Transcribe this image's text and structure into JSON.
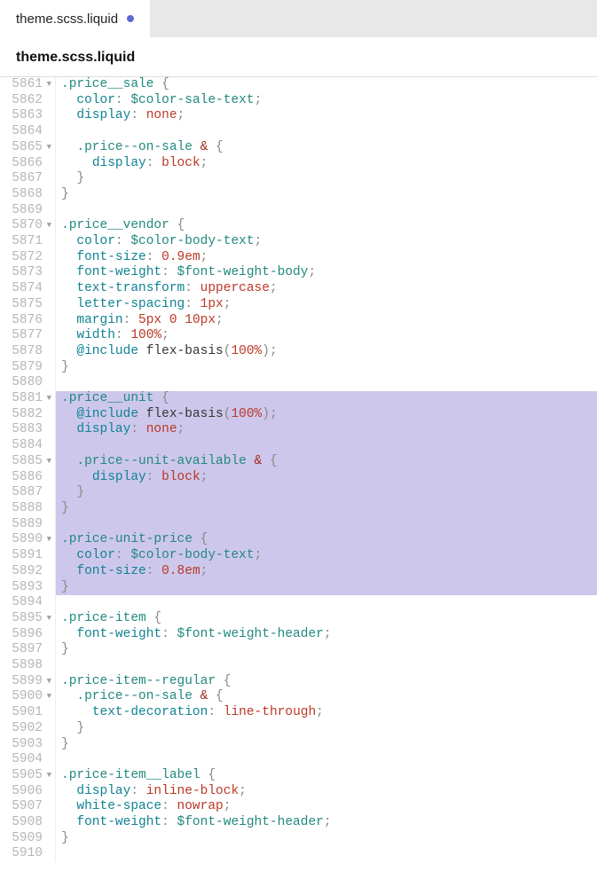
{
  "tab": {
    "filename": "theme.scss.liquid",
    "modified": true
  },
  "breadcrumb": "theme.scss.liquid",
  "gutter_start": 5861,
  "highlighted_range": [
    5881,
    5893
  ],
  "fold_lines": [
    5861,
    5865,
    5870,
    5881,
    5885,
    5890,
    5895,
    5899,
    5900,
    5905
  ],
  "lines": [
    {
      "n": 5861,
      "tokens": [
        [
          "sel",
          ".price__sale"
        ],
        [
          "punc",
          " {"
        ]
      ]
    },
    {
      "n": 5862,
      "tokens": [
        [
          "ws",
          "  "
        ],
        [
          "prop",
          "color"
        ],
        [
          "punc",
          ": "
        ],
        [
          "var",
          "$color-sale-text"
        ],
        [
          "punc",
          ";"
        ]
      ]
    },
    {
      "n": 5863,
      "tokens": [
        [
          "ws",
          "  "
        ],
        [
          "prop",
          "display"
        ],
        [
          "punc",
          ": "
        ],
        [
          "val",
          "none"
        ],
        [
          "punc",
          ";"
        ]
      ]
    },
    {
      "n": 5864,
      "tokens": []
    },
    {
      "n": 5865,
      "tokens": [
        [
          "ws",
          "  "
        ],
        [
          "sel",
          ".price--on-sale"
        ],
        [
          "punc",
          " "
        ],
        [
          "amp",
          "&"
        ],
        [
          "punc",
          " {"
        ]
      ]
    },
    {
      "n": 5866,
      "tokens": [
        [
          "ws",
          "    "
        ],
        [
          "prop",
          "display"
        ],
        [
          "punc",
          ": "
        ],
        [
          "val",
          "block"
        ],
        [
          "punc",
          ";"
        ]
      ]
    },
    {
      "n": 5867,
      "tokens": [
        [
          "ws",
          "  "
        ],
        [
          "brace",
          "}"
        ]
      ]
    },
    {
      "n": 5868,
      "tokens": [
        [
          "brace",
          "}"
        ]
      ]
    },
    {
      "n": 5869,
      "tokens": []
    },
    {
      "n": 5870,
      "tokens": [
        [
          "sel",
          ".price__vendor"
        ],
        [
          "punc",
          " {"
        ]
      ]
    },
    {
      "n": 5871,
      "tokens": [
        [
          "ws",
          "  "
        ],
        [
          "prop",
          "color"
        ],
        [
          "punc",
          ": "
        ],
        [
          "var",
          "$color-body-text"
        ],
        [
          "punc",
          ";"
        ]
      ]
    },
    {
      "n": 5872,
      "tokens": [
        [
          "ws",
          "  "
        ],
        [
          "prop",
          "font-size"
        ],
        [
          "punc",
          ": "
        ],
        [
          "val",
          "0.9em"
        ],
        [
          "punc",
          ";"
        ]
      ]
    },
    {
      "n": 5873,
      "tokens": [
        [
          "ws",
          "  "
        ],
        [
          "prop",
          "font-weight"
        ],
        [
          "punc",
          ": "
        ],
        [
          "var",
          "$font-weight-body"
        ],
        [
          "punc",
          ";"
        ]
      ]
    },
    {
      "n": 5874,
      "tokens": [
        [
          "ws",
          "  "
        ],
        [
          "prop",
          "text-transform"
        ],
        [
          "punc",
          ": "
        ],
        [
          "val",
          "uppercase"
        ],
        [
          "punc",
          ";"
        ]
      ]
    },
    {
      "n": 5875,
      "tokens": [
        [
          "ws",
          "  "
        ],
        [
          "prop",
          "letter-spacing"
        ],
        [
          "punc",
          ": "
        ],
        [
          "val",
          "1px"
        ],
        [
          "punc",
          ";"
        ]
      ]
    },
    {
      "n": 5876,
      "tokens": [
        [
          "ws",
          "  "
        ],
        [
          "prop",
          "margin"
        ],
        [
          "punc",
          ": "
        ],
        [
          "val",
          "5px 0 10px"
        ],
        [
          "punc",
          ";"
        ]
      ]
    },
    {
      "n": 5877,
      "tokens": [
        [
          "ws",
          "  "
        ],
        [
          "prop",
          "width"
        ],
        [
          "punc",
          ": "
        ],
        [
          "val",
          "100%"
        ],
        [
          "punc",
          ";"
        ]
      ]
    },
    {
      "n": 5878,
      "tokens": [
        [
          "ws",
          "  "
        ],
        [
          "at",
          "@include"
        ],
        [
          "punc",
          " "
        ],
        [
          "fn",
          "flex-basis"
        ],
        [
          "punc",
          "("
        ],
        [
          "val",
          "100%"
        ],
        [
          "punc",
          ");"
        ]
      ]
    },
    {
      "n": 5879,
      "tokens": [
        [
          "brace",
          "}"
        ]
      ]
    },
    {
      "n": 5880,
      "tokens": []
    },
    {
      "n": 5881,
      "tokens": [
        [
          "sel",
          ".price__unit"
        ],
        [
          "punc",
          " {"
        ]
      ]
    },
    {
      "n": 5882,
      "tokens": [
        [
          "ws",
          "  "
        ],
        [
          "at",
          "@include"
        ],
        [
          "punc",
          " "
        ],
        [
          "fn",
          "flex-basis"
        ],
        [
          "punc",
          "("
        ],
        [
          "val",
          "100%"
        ],
        [
          "punc",
          ");"
        ]
      ]
    },
    {
      "n": 5883,
      "tokens": [
        [
          "ws",
          "  "
        ],
        [
          "prop",
          "display"
        ],
        [
          "punc",
          ": "
        ],
        [
          "val",
          "none"
        ],
        [
          "punc",
          ";"
        ]
      ]
    },
    {
      "n": 5884,
      "tokens": []
    },
    {
      "n": 5885,
      "tokens": [
        [
          "ws",
          "  "
        ],
        [
          "sel",
          ".price--unit-available"
        ],
        [
          "punc",
          " "
        ],
        [
          "amp",
          "&"
        ],
        [
          "punc",
          " {"
        ]
      ]
    },
    {
      "n": 5886,
      "tokens": [
        [
          "ws",
          "    "
        ],
        [
          "prop",
          "display"
        ],
        [
          "punc",
          ": "
        ],
        [
          "val",
          "block"
        ],
        [
          "punc",
          ";"
        ]
      ]
    },
    {
      "n": 5887,
      "tokens": [
        [
          "ws",
          "  "
        ],
        [
          "brace",
          "}"
        ]
      ]
    },
    {
      "n": 5888,
      "tokens": [
        [
          "brace",
          "}"
        ]
      ]
    },
    {
      "n": 5889,
      "tokens": []
    },
    {
      "n": 5890,
      "tokens": [
        [
          "sel",
          ".price-unit-price"
        ],
        [
          "punc",
          " {"
        ]
      ]
    },
    {
      "n": 5891,
      "tokens": [
        [
          "ws",
          "  "
        ],
        [
          "prop",
          "color"
        ],
        [
          "punc",
          ": "
        ],
        [
          "var",
          "$color-body-text"
        ],
        [
          "punc",
          ";"
        ]
      ]
    },
    {
      "n": 5892,
      "tokens": [
        [
          "ws",
          "  "
        ],
        [
          "prop",
          "font-size"
        ],
        [
          "punc",
          ": "
        ],
        [
          "val",
          "0.8em"
        ],
        [
          "punc",
          ";"
        ]
      ]
    },
    {
      "n": 5893,
      "tokens": [
        [
          "brace",
          "}"
        ]
      ]
    },
    {
      "n": 5894,
      "tokens": []
    },
    {
      "n": 5895,
      "tokens": [
        [
          "sel",
          ".price-item"
        ],
        [
          "punc",
          " {"
        ]
      ]
    },
    {
      "n": 5896,
      "tokens": [
        [
          "ws",
          "  "
        ],
        [
          "prop",
          "font-weight"
        ],
        [
          "punc",
          ": "
        ],
        [
          "var",
          "$font-weight-header"
        ],
        [
          "punc",
          ";"
        ]
      ]
    },
    {
      "n": 5897,
      "tokens": [
        [
          "brace",
          "}"
        ]
      ]
    },
    {
      "n": 5898,
      "tokens": []
    },
    {
      "n": 5899,
      "tokens": [
        [
          "sel",
          ".price-item--regular"
        ],
        [
          "punc",
          " {"
        ]
      ]
    },
    {
      "n": 5900,
      "tokens": [
        [
          "ws",
          "  "
        ],
        [
          "sel",
          ".price--on-sale"
        ],
        [
          "punc",
          " "
        ],
        [
          "amp",
          "&"
        ],
        [
          "punc",
          " {"
        ]
      ]
    },
    {
      "n": 5901,
      "tokens": [
        [
          "ws",
          "    "
        ],
        [
          "prop",
          "text-decoration"
        ],
        [
          "punc",
          ": "
        ],
        [
          "val",
          "line-through"
        ],
        [
          "punc",
          ";"
        ]
      ]
    },
    {
      "n": 5902,
      "tokens": [
        [
          "ws",
          "  "
        ],
        [
          "brace",
          "}"
        ]
      ]
    },
    {
      "n": 5903,
      "tokens": [
        [
          "brace",
          "}"
        ]
      ]
    },
    {
      "n": 5904,
      "tokens": []
    },
    {
      "n": 5905,
      "tokens": [
        [
          "sel",
          ".price-item__label"
        ],
        [
          "punc",
          " {"
        ]
      ]
    },
    {
      "n": 5906,
      "tokens": [
        [
          "ws",
          "  "
        ],
        [
          "prop",
          "display"
        ],
        [
          "punc",
          ": "
        ],
        [
          "val",
          "inline-block"
        ],
        [
          "punc",
          ";"
        ]
      ]
    },
    {
      "n": 5907,
      "tokens": [
        [
          "ws",
          "  "
        ],
        [
          "prop",
          "white-space"
        ],
        [
          "punc",
          ": "
        ],
        [
          "val",
          "nowrap"
        ],
        [
          "punc",
          ";"
        ]
      ]
    },
    {
      "n": 5908,
      "tokens": [
        [
          "ws",
          "  "
        ],
        [
          "prop",
          "font-weight"
        ],
        [
          "punc",
          ": "
        ],
        [
          "var",
          "$font-weight-header"
        ],
        [
          "punc",
          ";"
        ]
      ]
    },
    {
      "n": 5909,
      "tokens": [
        [
          "brace",
          "}"
        ]
      ]
    },
    {
      "n": 5910,
      "tokens": []
    }
  ]
}
